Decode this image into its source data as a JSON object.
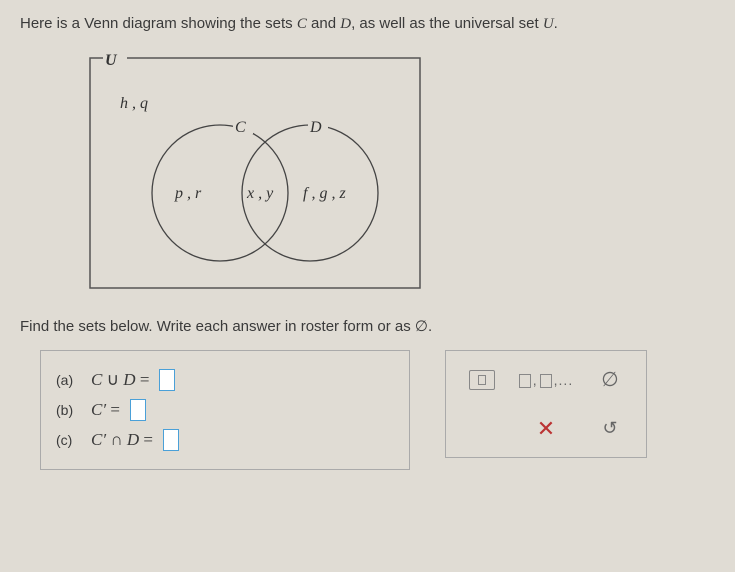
{
  "intro_pre": "Here is a Venn diagram showing the sets ",
  "set_c": "C",
  "intro_and": " and ",
  "set_d": "D",
  "intro_post": ", as well as the universal set ",
  "set_u": "U",
  "intro_end": ".",
  "venn": {
    "U": "U",
    "C": "C",
    "D": "D",
    "outside": "h , q",
    "c_only": "p , r",
    "inter": "x , y",
    "d_only": "f , g , z"
  },
  "prompt_pre": "Find the sets below. Write each answer in roster form or as ",
  "empty": "∅",
  "prompt_end": ".",
  "answers": {
    "a": {
      "label": "(a)",
      "expr": "C ∪ D ="
    },
    "b": {
      "label": "(b)",
      "expr": "C′ ="
    },
    "c": {
      "label": "(c)",
      "expr": "C′ ∩ D ="
    }
  },
  "tools": {
    "empty": "∅",
    "x": "✕",
    "reset": "↺"
  }
}
